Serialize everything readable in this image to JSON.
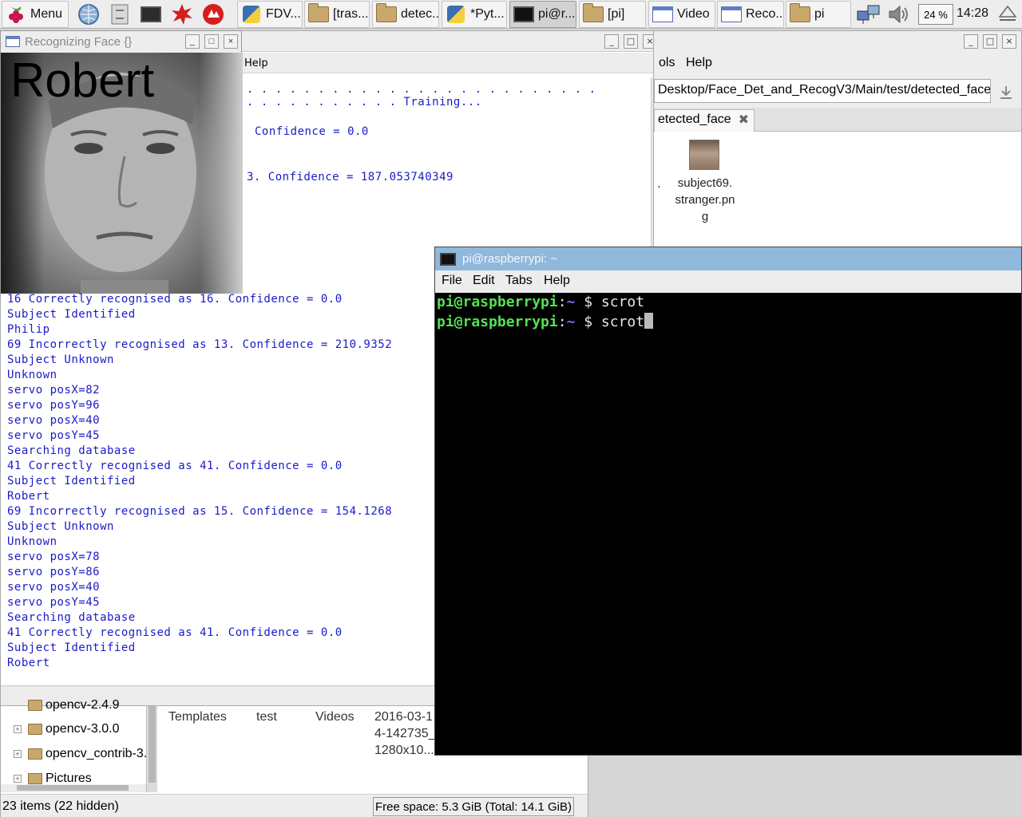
{
  "panel": {
    "menu_label": "Menu",
    "tasks": [
      {
        "label": "FDV...",
        "icon": "python-icon"
      },
      {
        "label": "[tras...",
        "icon": "folder-icon"
      },
      {
        "label": "detec...",
        "icon": "folder-icon"
      },
      {
        "label": "*Pyt...",
        "icon": "python-icon"
      },
      {
        "label": "pi@r...",
        "icon": "terminal-icon"
      },
      {
        "label": "[pi]",
        "icon": "folder-icon"
      },
      {
        "label": "Video",
        "icon": "window-icon"
      },
      {
        "label": "Reco...",
        "icon": "window-icon"
      },
      {
        "label": "pi",
        "icon": "folder-icon"
      }
    ],
    "cpu": "24 %",
    "clock": "14:28"
  },
  "face_window": {
    "title": "Recognizing Face {}",
    "name": "Robert"
  },
  "python_shell": {
    "menu_help": "Help",
    "top_lines": [
      ". . . . . . . . . . . . . . . . . . . . . . . . .",
      ". . . . . . . . . . . Training...",
      "Confidence = 0.0",
      "3. Confidence = 187.053740349"
    ],
    "lines": [
      "16 Correctly recognised as 16. Confidence = 0.0",
      "Subject Identified",
      "Philip",
      "69 Incorrectly recognised as 13. Confidence = 210.9352",
      "Subject Unknown",
      "Unknown",
      "servo posX=82",
      "servo posY=96",
      "servo posX=40",
      "servo posY=45",
      "Searching database",
      "41 Correctly recognised as 41. Confidence = 0.0",
      "Subject Identified",
      "Robert",
      "69 Incorrectly recognised as 15. Confidence = 154.1268",
      "Subject Unknown",
      "Unknown",
      "servo posX=78",
      "servo posY=86",
      "servo posX=40",
      "servo posY=45",
      "Searching database",
      "41 Correctly recognised as 41. Confidence = 0.0",
      "Subject Identified",
      "Robert"
    ]
  },
  "file_manager_top": {
    "menu": [
      "ols",
      "Help"
    ],
    "path": "Desktop/Face_Det_and_RecogV3/Main/test/detected_face",
    "tab": "etected_face",
    "file_lines": [
      "subject69.",
      "stranger.pn",
      "g"
    ],
    "left_fragment": "."
  },
  "file_manager_bottom": {
    "tree": [
      {
        "label": "opencv-2.4.9"
      },
      {
        "label": "opencv-3.0.0"
      },
      {
        "label": "opencv_contrib-3.("
      },
      {
        "label": "Pictures"
      }
    ],
    "cells": [
      {
        "text": "Templates"
      },
      {
        "text": "test"
      },
      {
        "text": "Videos"
      },
      {
        "text": "2016-03-1\n4-142735_\n1280x10..."
      }
    ],
    "status_left": "23 items (22 hidden)",
    "status_right": "Free space: 5.3 GiB (Total: 14.1 GiB)"
  },
  "terminal": {
    "title": "pi@raspberrypi: ~",
    "menu": [
      "File",
      "Edit",
      "Tabs",
      "Help"
    ],
    "lines": [
      {
        "user": "pi@raspberrypi",
        "sep": ":",
        "path": "~",
        "prompt": " $ ",
        "cmd": "scrot"
      },
      {
        "user": "pi@raspberrypi",
        "sep": ":",
        "path": "~",
        "prompt": " $ ",
        "cmd": "scrot"
      }
    ]
  }
}
